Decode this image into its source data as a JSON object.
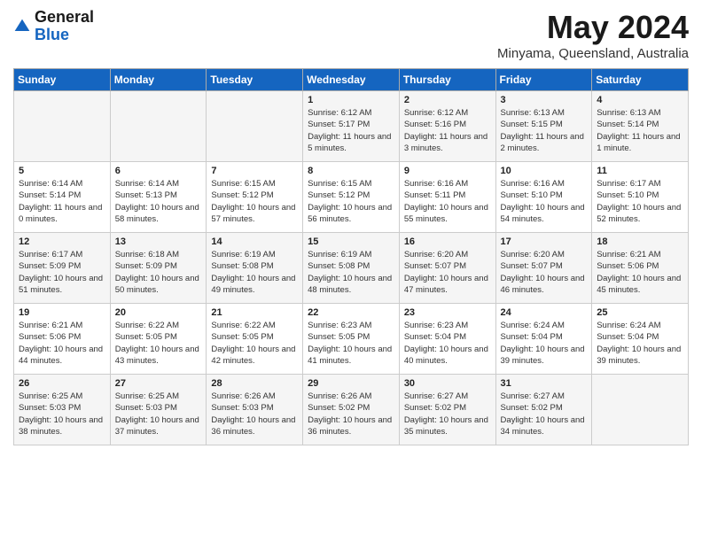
{
  "header": {
    "logo_general": "General",
    "logo_blue": "Blue",
    "month": "May 2024",
    "location": "Minyama, Queensland, Australia"
  },
  "days_of_week": [
    "Sunday",
    "Monday",
    "Tuesday",
    "Wednesday",
    "Thursday",
    "Friday",
    "Saturday"
  ],
  "weeks": [
    [
      {
        "day": "",
        "text": ""
      },
      {
        "day": "",
        "text": ""
      },
      {
        "day": "",
        "text": ""
      },
      {
        "day": "1",
        "text": "Sunrise: 6:12 AM\nSunset: 5:17 PM\nDaylight: 11 hours and 5 minutes."
      },
      {
        "day": "2",
        "text": "Sunrise: 6:12 AM\nSunset: 5:16 PM\nDaylight: 11 hours and 3 minutes."
      },
      {
        "day": "3",
        "text": "Sunrise: 6:13 AM\nSunset: 5:15 PM\nDaylight: 11 hours and 2 minutes."
      },
      {
        "day": "4",
        "text": "Sunrise: 6:13 AM\nSunset: 5:14 PM\nDaylight: 11 hours and 1 minute."
      }
    ],
    [
      {
        "day": "5",
        "text": "Sunrise: 6:14 AM\nSunset: 5:14 PM\nDaylight: 11 hours and 0 minutes."
      },
      {
        "day": "6",
        "text": "Sunrise: 6:14 AM\nSunset: 5:13 PM\nDaylight: 10 hours and 58 minutes."
      },
      {
        "day": "7",
        "text": "Sunrise: 6:15 AM\nSunset: 5:12 PM\nDaylight: 10 hours and 57 minutes."
      },
      {
        "day": "8",
        "text": "Sunrise: 6:15 AM\nSunset: 5:12 PM\nDaylight: 10 hours and 56 minutes."
      },
      {
        "day": "9",
        "text": "Sunrise: 6:16 AM\nSunset: 5:11 PM\nDaylight: 10 hours and 55 minutes."
      },
      {
        "day": "10",
        "text": "Sunrise: 6:16 AM\nSunset: 5:10 PM\nDaylight: 10 hours and 54 minutes."
      },
      {
        "day": "11",
        "text": "Sunrise: 6:17 AM\nSunset: 5:10 PM\nDaylight: 10 hours and 52 minutes."
      }
    ],
    [
      {
        "day": "12",
        "text": "Sunrise: 6:17 AM\nSunset: 5:09 PM\nDaylight: 10 hours and 51 minutes."
      },
      {
        "day": "13",
        "text": "Sunrise: 6:18 AM\nSunset: 5:09 PM\nDaylight: 10 hours and 50 minutes."
      },
      {
        "day": "14",
        "text": "Sunrise: 6:19 AM\nSunset: 5:08 PM\nDaylight: 10 hours and 49 minutes."
      },
      {
        "day": "15",
        "text": "Sunrise: 6:19 AM\nSunset: 5:08 PM\nDaylight: 10 hours and 48 minutes."
      },
      {
        "day": "16",
        "text": "Sunrise: 6:20 AM\nSunset: 5:07 PM\nDaylight: 10 hours and 47 minutes."
      },
      {
        "day": "17",
        "text": "Sunrise: 6:20 AM\nSunset: 5:07 PM\nDaylight: 10 hours and 46 minutes."
      },
      {
        "day": "18",
        "text": "Sunrise: 6:21 AM\nSunset: 5:06 PM\nDaylight: 10 hours and 45 minutes."
      }
    ],
    [
      {
        "day": "19",
        "text": "Sunrise: 6:21 AM\nSunset: 5:06 PM\nDaylight: 10 hours and 44 minutes."
      },
      {
        "day": "20",
        "text": "Sunrise: 6:22 AM\nSunset: 5:05 PM\nDaylight: 10 hours and 43 minutes."
      },
      {
        "day": "21",
        "text": "Sunrise: 6:22 AM\nSunset: 5:05 PM\nDaylight: 10 hours and 42 minutes."
      },
      {
        "day": "22",
        "text": "Sunrise: 6:23 AM\nSunset: 5:05 PM\nDaylight: 10 hours and 41 minutes."
      },
      {
        "day": "23",
        "text": "Sunrise: 6:23 AM\nSunset: 5:04 PM\nDaylight: 10 hours and 40 minutes."
      },
      {
        "day": "24",
        "text": "Sunrise: 6:24 AM\nSunset: 5:04 PM\nDaylight: 10 hours and 39 minutes."
      },
      {
        "day": "25",
        "text": "Sunrise: 6:24 AM\nSunset: 5:04 PM\nDaylight: 10 hours and 39 minutes."
      }
    ],
    [
      {
        "day": "26",
        "text": "Sunrise: 6:25 AM\nSunset: 5:03 PM\nDaylight: 10 hours and 38 minutes."
      },
      {
        "day": "27",
        "text": "Sunrise: 6:25 AM\nSunset: 5:03 PM\nDaylight: 10 hours and 37 minutes."
      },
      {
        "day": "28",
        "text": "Sunrise: 6:26 AM\nSunset: 5:03 PM\nDaylight: 10 hours and 36 minutes."
      },
      {
        "day": "29",
        "text": "Sunrise: 6:26 AM\nSunset: 5:02 PM\nDaylight: 10 hours and 36 minutes."
      },
      {
        "day": "30",
        "text": "Sunrise: 6:27 AM\nSunset: 5:02 PM\nDaylight: 10 hours and 35 minutes."
      },
      {
        "day": "31",
        "text": "Sunrise: 6:27 AM\nSunset: 5:02 PM\nDaylight: 10 hours and 34 minutes."
      },
      {
        "day": "",
        "text": ""
      }
    ]
  ]
}
